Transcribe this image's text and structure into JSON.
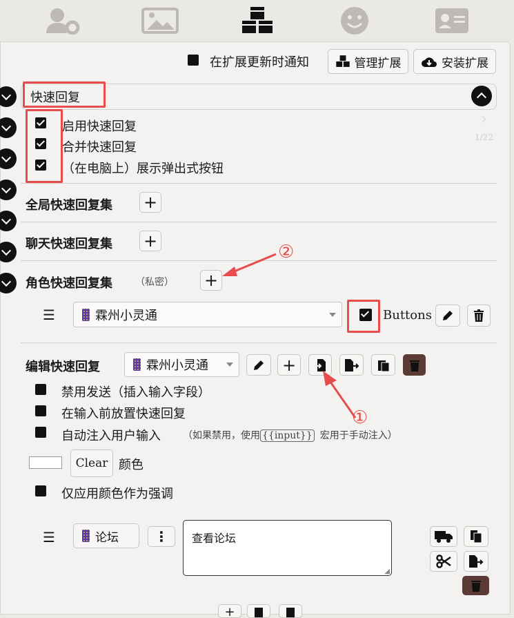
{
  "tabs": [
    "user-settings-icon",
    "image-icon",
    "cubes-icon",
    "smile-icon",
    "id-card-icon"
  ],
  "header": {
    "notify_label": "在扩展更新时通知",
    "manage_label": "管理扩展",
    "install_label": "安装扩展"
  },
  "quick_reply": {
    "title": "快速回复",
    "options": [
      "启用快速回复",
      "合并快速回复",
      "（在电脑上）展示弹出式按钮"
    ],
    "global_sets": "全局快速回复集",
    "chat_sets": "聊天快速回复集",
    "char_sets": "角色快速回复集",
    "char_private": "（私密）",
    "set_selected": "霖州小灵通",
    "buttons_label": "Buttons"
  },
  "ghost": {
    "count": "1/22"
  },
  "edit": {
    "title": "编辑快速回复",
    "set_selected": "霖州小灵通",
    "options": [
      "禁用发送（插入输入字段）",
      "在输入前放置快速回复",
      "自动注入用户输入"
    ],
    "note_prefix": "（如果禁用，使用",
    "note_macro": "{{input}}",
    "note_suffix": "宏用于手动注入）",
    "clear_label": "Clear",
    "color_label": "颜色",
    "accent_label": "仅应用颜色作为强调"
  },
  "entry": {
    "name": "论坛",
    "message": "查看论坛"
  },
  "annotations": {
    "one": "①",
    "two": "②"
  },
  "colors": {
    "red": "#e84b4b",
    "dark": "#111111",
    "brown": "#5c3a36"
  }
}
